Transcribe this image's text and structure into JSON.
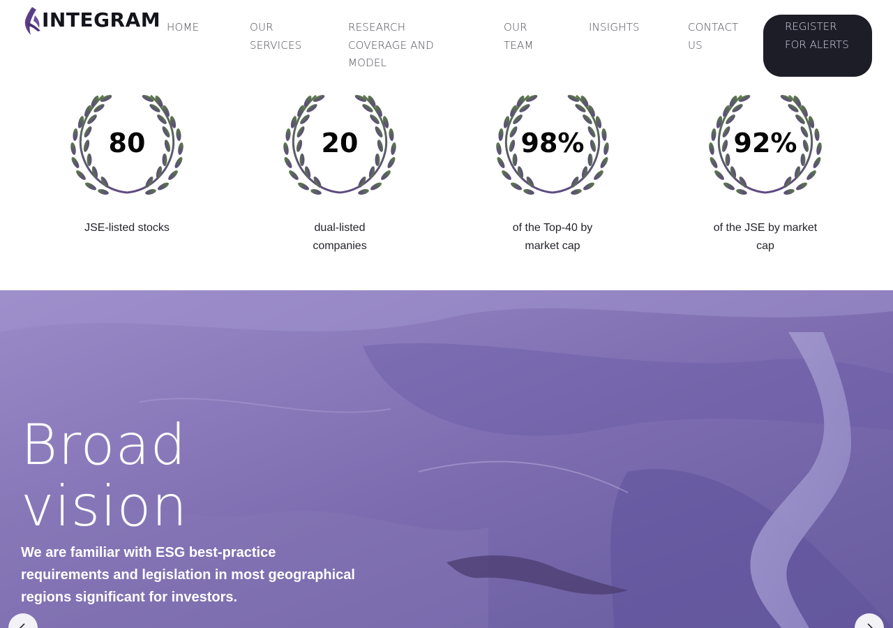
{
  "brand": {
    "name": "INTEGRAM",
    "logo_icon": "eagle-logo-icon"
  },
  "nav": {
    "items": [
      {
        "id": "home",
        "lines": [
          "HOME"
        ]
      },
      {
        "id": "services",
        "lines": [
          "OUR",
          "SERVICES"
        ]
      },
      {
        "id": "research",
        "lines": [
          "RESEARCH",
          "COVERAGE AND",
          "MODEL"
        ]
      },
      {
        "id": "team",
        "lines": [
          "OUR",
          "TEAM"
        ]
      },
      {
        "id": "insights",
        "lines": [
          "INSIGHTS"
        ]
      },
      {
        "id": "contact",
        "lines": [
          "CONTACT",
          "US"
        ]
      }
    ],
    "register": {
      "lines": [
        "REGISTER",
        "FOR ALERTS"
      ]
    }
  },
  "stats": [
    {
      "value": "80",
      "label": "JSE-listed stocks"
    },
    {
      "value": "20",
      "label": "dual-listed companies"
    },
    {
      "value": "98%",
      "label": "of the Top-40 by market cap"
    },
    {
      "value": "92%",
      "label": "of the JSE by market cap"
    }
  ],
  "hero": {
    "title_line1": "Broad",
    "title_line2": "vision",
    "text": "We are familiar with ESG best-practice requirements and legislation in most geographical regions significant for investors."
  },
  "colors": {
    "accent_dark": "#1d1d27",
    "wreath_green": "#5d7a4a",
    "wreath_purple": "#5e4a80",
    "hero_purple": "#8a7abb"
  },
  "icons": {
    "prev": "chevron-left-icon",
    "next": "chevron-right-icon",
    "wreath": "laurel-wreath-icon"
  }
}
